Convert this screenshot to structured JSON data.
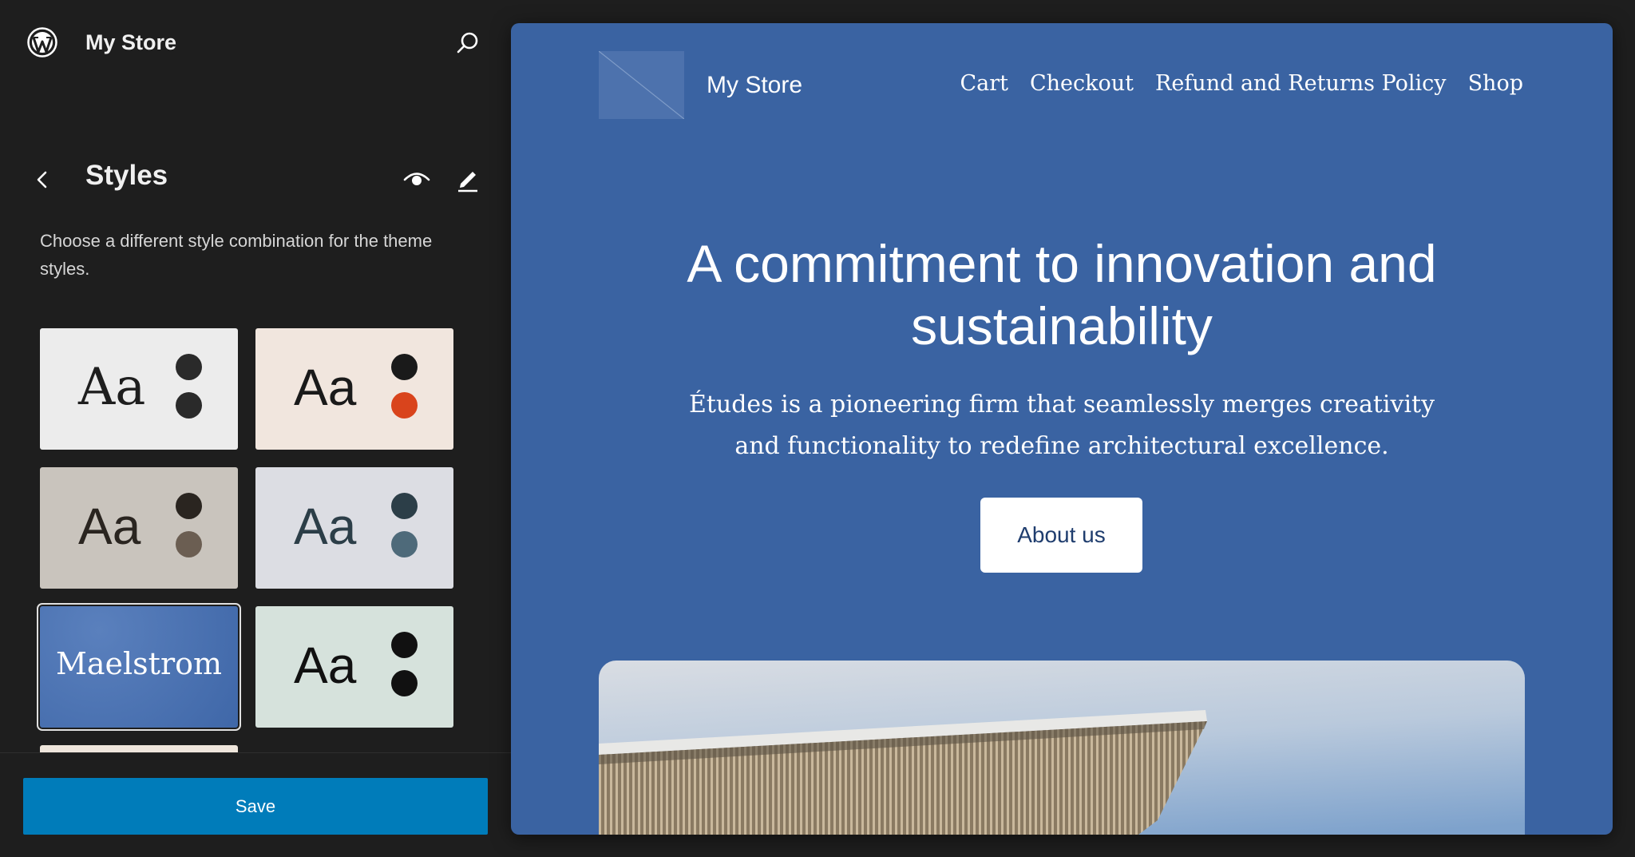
{
  "sidebar": {
    "site_name": "My Store",
    "panel_title": "Styles",
    "description": "Choose a different style combination for the theme styles.",
    "variations": [
      {
        "label": "Aa",
        "bg": "#ececec",
        "text": "#1e1e1e",
        "dots": [
          "#2a2a2a",
          "#2a2a2a"
        ],
        "serif": true
      },
      {
        "label": "Aa",
        "bg": "#f1e6de",
        "text": "#1a1a1a",
        "dots": [
          "#1a1a1a",
          "#d9441c"
        ],
        "serif": false
      },
      {
        "label": "Aa",
        "bg": "#c9c4bd",
        "text": "#2a2520",
        "dots": [
          "#2a2520",
          "#6b5e52"
        ],
        "serif": false
      },
      {
        "label": "Aa",
        "bg": "#dcdde3",
        "text": "#2c3e48",
        "dots": [
          "#2c3e48",
          "#4e6a7a"
        ],
        "serif": false
      },
      {
        "label": "Maelstrom",
        "bg": "#3f67a8",
        "text": "#ffffff",
        "dots": [],
        "serif": true
      },
      {
        "label": "Aa",
        "bg": "#d6e2dc",
        "text": "#111111",
        "dots": [
          "#111111",
          "#111111"
        ],
        "serif": false
      },
      {
        "label": "",
        "bg": "#efe6dc",
        "text": "#111111",
        "dots": [],
        "serif": false
      }
    ],
    "save_label": "Save"
  },
  "preview": {
    "site_title": "My Store",
    "nav": [
      "Cart",
      "Checkout",
      "Refund and Returns Policy",
      "Shop"
    ],
    "hero_title": "A commitment to innovation and sustainability",
    "hero_text": "Études is a pioneering firm that seamlessly merges creativity and functionality to redefine architectural excellence.",
    "button_label": "About us",
    "accent": "#3a63a2"
  },
  "colors": {
    "sidebar_bg": "#1e1e1e",
    "save_button": "#007cba"
  },
  "icons": [
    "wordpress-logo-icon",
    "search-icon",
    "chevron-left-icon",
    "eye-icon",
    "pencil-icon"
  ]
}
